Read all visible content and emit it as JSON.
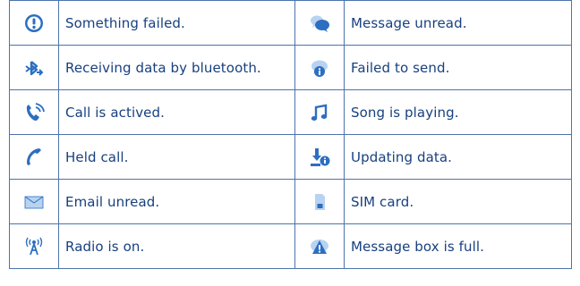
{
  "colors": {
    "text": "#17407f",
    "border": "#4d73ad",
    "icon_blue": "#2c6fc0",
    "icon_light": "#b8d3f1"
  },
  "rows": [
    {
      "left": {
        "icon": "exclamation-circle-icon",
        "label": "Something failed."
      },
      "right": {
        "icon": "chat-bubbles-icon",
        "label": "Message unread."
      }
    },
    {
      "left": {
        "icon": "bluetooth-icon",
        "label": "Receiving data by bluetooth."
      },
      "right": {
        "icon": "send-failed-icon",
        "label": "Failed to send."
      }
    },
    {
      "left": {
        "icon": "active-call-icon",
        "label": "Call is actived."
      },
      "right": {
        "icon": "music-note-icon",
        "label": "Song is playing."
      }
    },
    {
      "left": {
        "icon": "held-call-icon",
        "label": "Held call."
      },
      "right": {
        "icon": "updating-data-icon",
        "label": "Updating data."
      }
    },
    {
      "left": {
        "icon": "email-envelope-icon",
        "label": "Email unread."
      },
      "right": {
        "icon": "sim-card-icon",
        "label": "SIM card."
      }
    },
    {
      "left": {
        "icon": "radio-antenna-icon",
        "label": "Radio is on."
      },
      "right": {
        "icon": "message-box-full-icon",
        "label": "Message box is full."
      }
    }
  ]
}
